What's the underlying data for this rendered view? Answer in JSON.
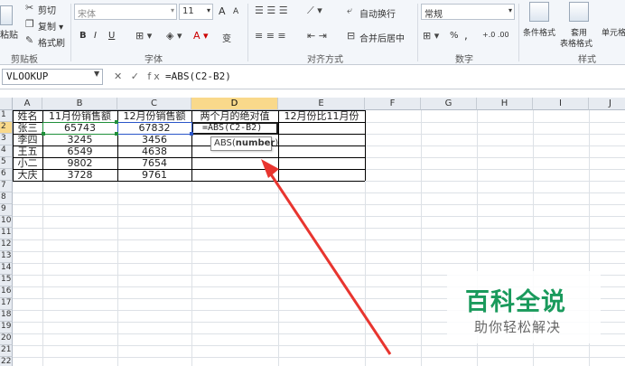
{
  "ribbon": {
    "clipboard": {
      "paste": "粘贴",
      "cut": "剪切",
      "copy": "复制 ▾",
      "format_painter": "格式刷",
      "group": "剪贴板"
    },
    "font": {
      "name": "宋体",
      "size": "11",
      "group": "字体",
      "bold": "B",
      "italic": "I",
      "underline": "U",
      "grow": "A",
      "shrink": "A",
      "wen": "变"
    },
    "alignment": {
      "wrap": "自动换行",
      "merge": "合并后居中",
      "group": "对齐方式"
    },
    "number": {
      "format": "常规",
      "percent": "%",
      "comma": ",",
      "inc_dec": "+.0 .00",
      "dec_dec": ".00 +.0",
      "group": "数字"
    },
    "styles": {
      "conditional": "条件格式",
      "table": "套用",
      "table2": "表格格式",
      "cell": "单元格",
      "group": "样式"
    }
  },
  "formula_bar": {
    "name_box": "VLOOKUP",
    "icons": "✕ ✓ fx",
    "formula": "=ABS(C2-B2)"
  },
  "columns": [
    "A",
    "B",
    "C",
    "D",
    "E",
    "F",
    "G",
    "H",
    "I",
    "J"
  ],
  "rows": [
    "1",
    "2",
    "3",
    "4",
    "5",
    "6",
    "7",
    "8",
    "9",
    "10",
    "11",
    "12",
    "13",
    "14",
    "15",
    "16",
    "17",
    "18",
    "19",
    "20",
    "21",
    "22"
  ],
  "table": {
    "headers": [
      "姓名",
      "11月份销售额",
      "12月份销售额",
      "两个月的绝对值",
      "12月份比11月份"
    ],
    "rows": [
      [
        "张三",
        "65743",
        "67832"
      ],
      [
        "李四",
        "3245",
        "3456"
      ],
      [
        "王五",
        "6549",
        "4638"
      ],
      [
        "小二",
        "9802",
        "7654"
      ],
      [
        "大庆",
        "3728",
        "9761"
      ]
    ],
    "editing_cell": "=ABS(C2-B2)"
  },
  "tooltip": {
    "fn": "ABS(",
    "arg": "number",
    "close": ")"
  },
  "watermark": {
    "title": "百科全说",
    "subtitle": "助你轻松解决"
  },
  "colors": {
    "accent_arrow": "#e8352f",
    "selected_header": "#f9d98b",
    "watermark_green": "#1a9a5c"
  }
}
